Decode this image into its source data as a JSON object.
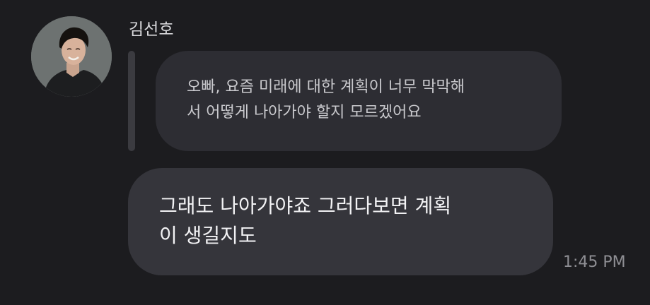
{
  "conversation": {
    "sender_name": "김선호",
    "avatar_icon": "contact-photo",
    "quoted_message": {
      "line1": "오빠, 요즘 미래에 대한 계획이 너무 막막해",
      "line2": "서 어떻게 나아가야 할지 모르겠어요"
    },
    "message": {
      "line1": "그래도 나아가야죠 그러다보면 계획",
      "line2": "이 생길지도"
    },
    "timestamp": "1:45 PM"
  },
  "colors": {
    "background": "#1c1c1f",
    "quoted_bubble": "#2d2d33",
    "main_bubble": "#35353b",
    "reply_bar": "#3b3b40",
    "timestamp": "#8e8e93"
  }
}
